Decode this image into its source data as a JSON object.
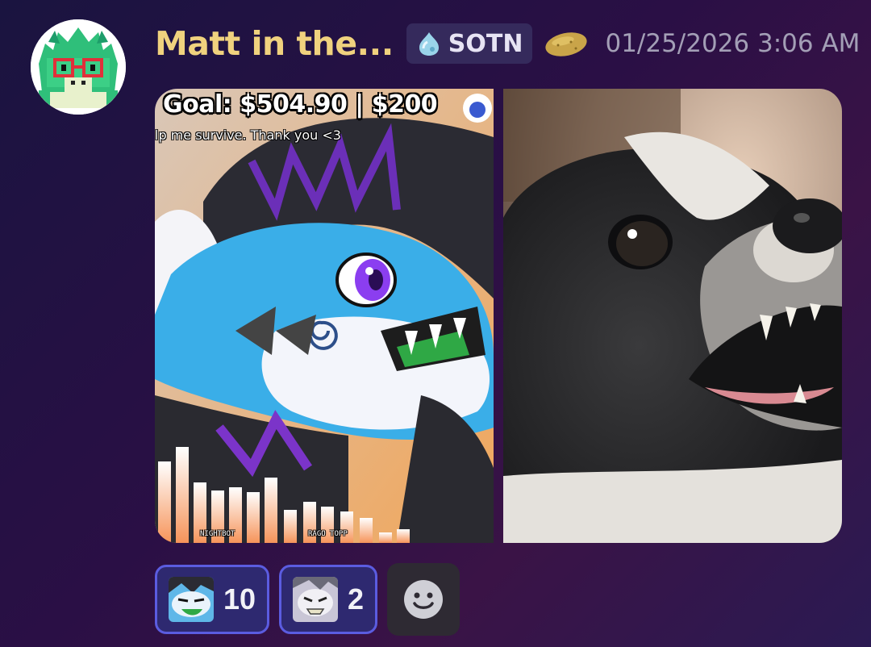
{
  "message": {
    "author": "Matt in the...",
    "role_tag": {
      "icon": "water-drop-icon",
      "label": "SOTN"
    },
    "badge_icon": "potato-icon",
    "timestamp": "01/25/2026 3:06 AM",
    "avatar_icon": "dragon-avatar-icon"
  },
  "attachments": [
    {
      "kind": "stream-screenshot",
      "overlay_goal": "Goal: $504.90 | $200",
      "overlay_subtitle": "lp me survive. Thank you <3",
      "overlay_names": [
        "NIGHTBOT",
        "RAGO TOPP"
      ]
    },
    {
      "kind": "photo",
      "subject": "dog-photo"
    }
  ],
  "reactions": [
    {
      "emoji": "blue-dragon-emoji",
      "count": "10",
      "selected": true
    },
    {
      "emoji": "white-dragon-emoji",
      "count": "2",
      "selected": true
    }
  ],
  "add_reaction_icon": "smiley-add-reaction-icon",
  "colors": {
    "username": "#f0d27e",
    "timestamp": "#a39fb6",
    "reaction_border": "#5b5ce0",
    "reaction_bg": "#2e2970"
  }
}
